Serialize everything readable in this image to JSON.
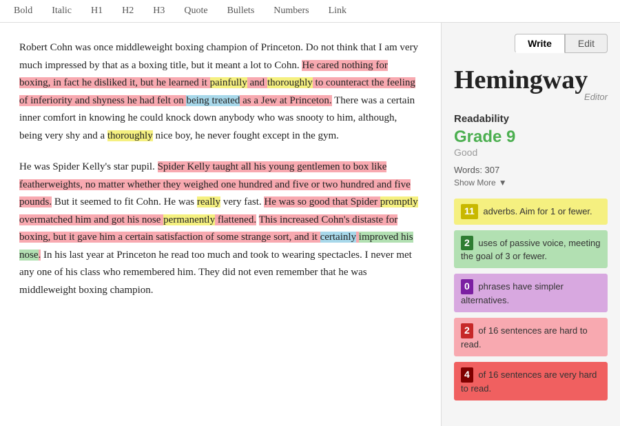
{
  "toolbar": {
    "buttons": [
      "Bold",
      "Italic",
      "H1",
      "H2",
      "H3",
      "Quote",
      "Bullets",
      "Numbers",
      "Link"
    ]
  },
  "tabs": {
    "write": "Write",
    "edit": "Edit"
  },
  "sidebar": {
    "app_title": "Hemingway",
    "app_subtitle": "Editor",
    "readability_label": "Readability",
    "grade_label": "Grade 9",
    "good_label": "Good",
    "words_label": "Words: 307",
    "show_more": "Show More",
    "stats": [
      {
        "num": "11",
        "text": "adverbs. Aim for 1 or fewer.",
        "card_class": "card-yellow"
      },
      {
        "num": "2",
        "text": "uses of passive voice, meeting the goal of 3 or fewer.",
        "card_class": "card-green"
      },
      {
        "num": "0",
        "text": "phrases have simpler alternatives.",
        "card_class": "card-purple"
      },
      {
        "num": "2",
        "text": "of 16 sentences are hard to read.",
        "card_class": "card-red"
      },
      {
        "num": "4",
        "text": "of 16 sentences are very hard to read.",
        "card_class": "card-darkred"
      }
    ]
  },
  "editor": {
    "paragraphs": [
      "Robert Cohn was once middleweight boxing champion of Princeton. Do not think that I am very much impressed by that as a boxing title, but it meant a lot to Cohn.",
      "There was a certain inner comfort in knowing he could knock down anybody who was snooty to him, although, being very shy and a thoroughly nice boy, he never fought except in the gym.",
      "He was Spider Kelly's star pupil.",
      "But it seemed to fit Cohn. He was really very fast.",
      "This increased Cohn's distaste for boxing, but it gave him a certain satisfaction of some strange sort, and it certainly improved his nose.",
      "In his last year at Princeton he read too much and took to wearing spectacles. I never met any one of his class who remembered him. They did not even remember that he was middleweight boxing champion."
    ]
  }
}
